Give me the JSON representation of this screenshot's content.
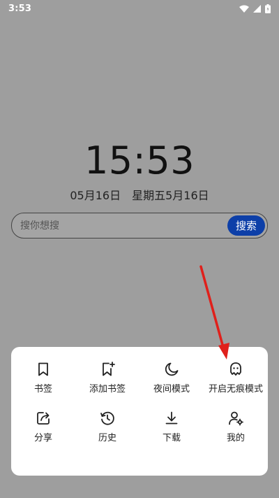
{
  "status_bar": {
    "time": "3:53"
  },
  "clock": {
    "time": "15:53"
  },
  "date": {
    "solar": "05月16日",
    "weekday_lunar": "星期五5月16日"
  },
  "search": {
    "placeholder": "搜你想搜",
    "button_label": "搜索"
  },
  "menu": {
    "items": [
      {
        "label": "书签",
        "icon": "bookmark-icon"
      },
      {
        "label": "添加书签",
        "icon": "add-bookmark-icon"
      },
      {
        "label": "夜间模式",
        "icon": "moon-icon"
      },
      {
        "label": "开启无痕模式",
        "icon": "ghost-icon"
      },
      {
        "label": "分享",
        "icon": "share-icon"
      },
      {
        "label": "历史",
        "icon": "history-icon"
      },
      {
        "label": "下载",
        "icon": "download-icon"
      },
      {
        "label": "我的",
        "icon": "user-settings-icon"
      }
    ]
  },
  "colors": {
    "overlay": "#9e9e9e",
    "search_button": "#0d3fa8",
    "panel": "#ffffff",
    "annotation_arrow": "#e0201b"
  }
}
